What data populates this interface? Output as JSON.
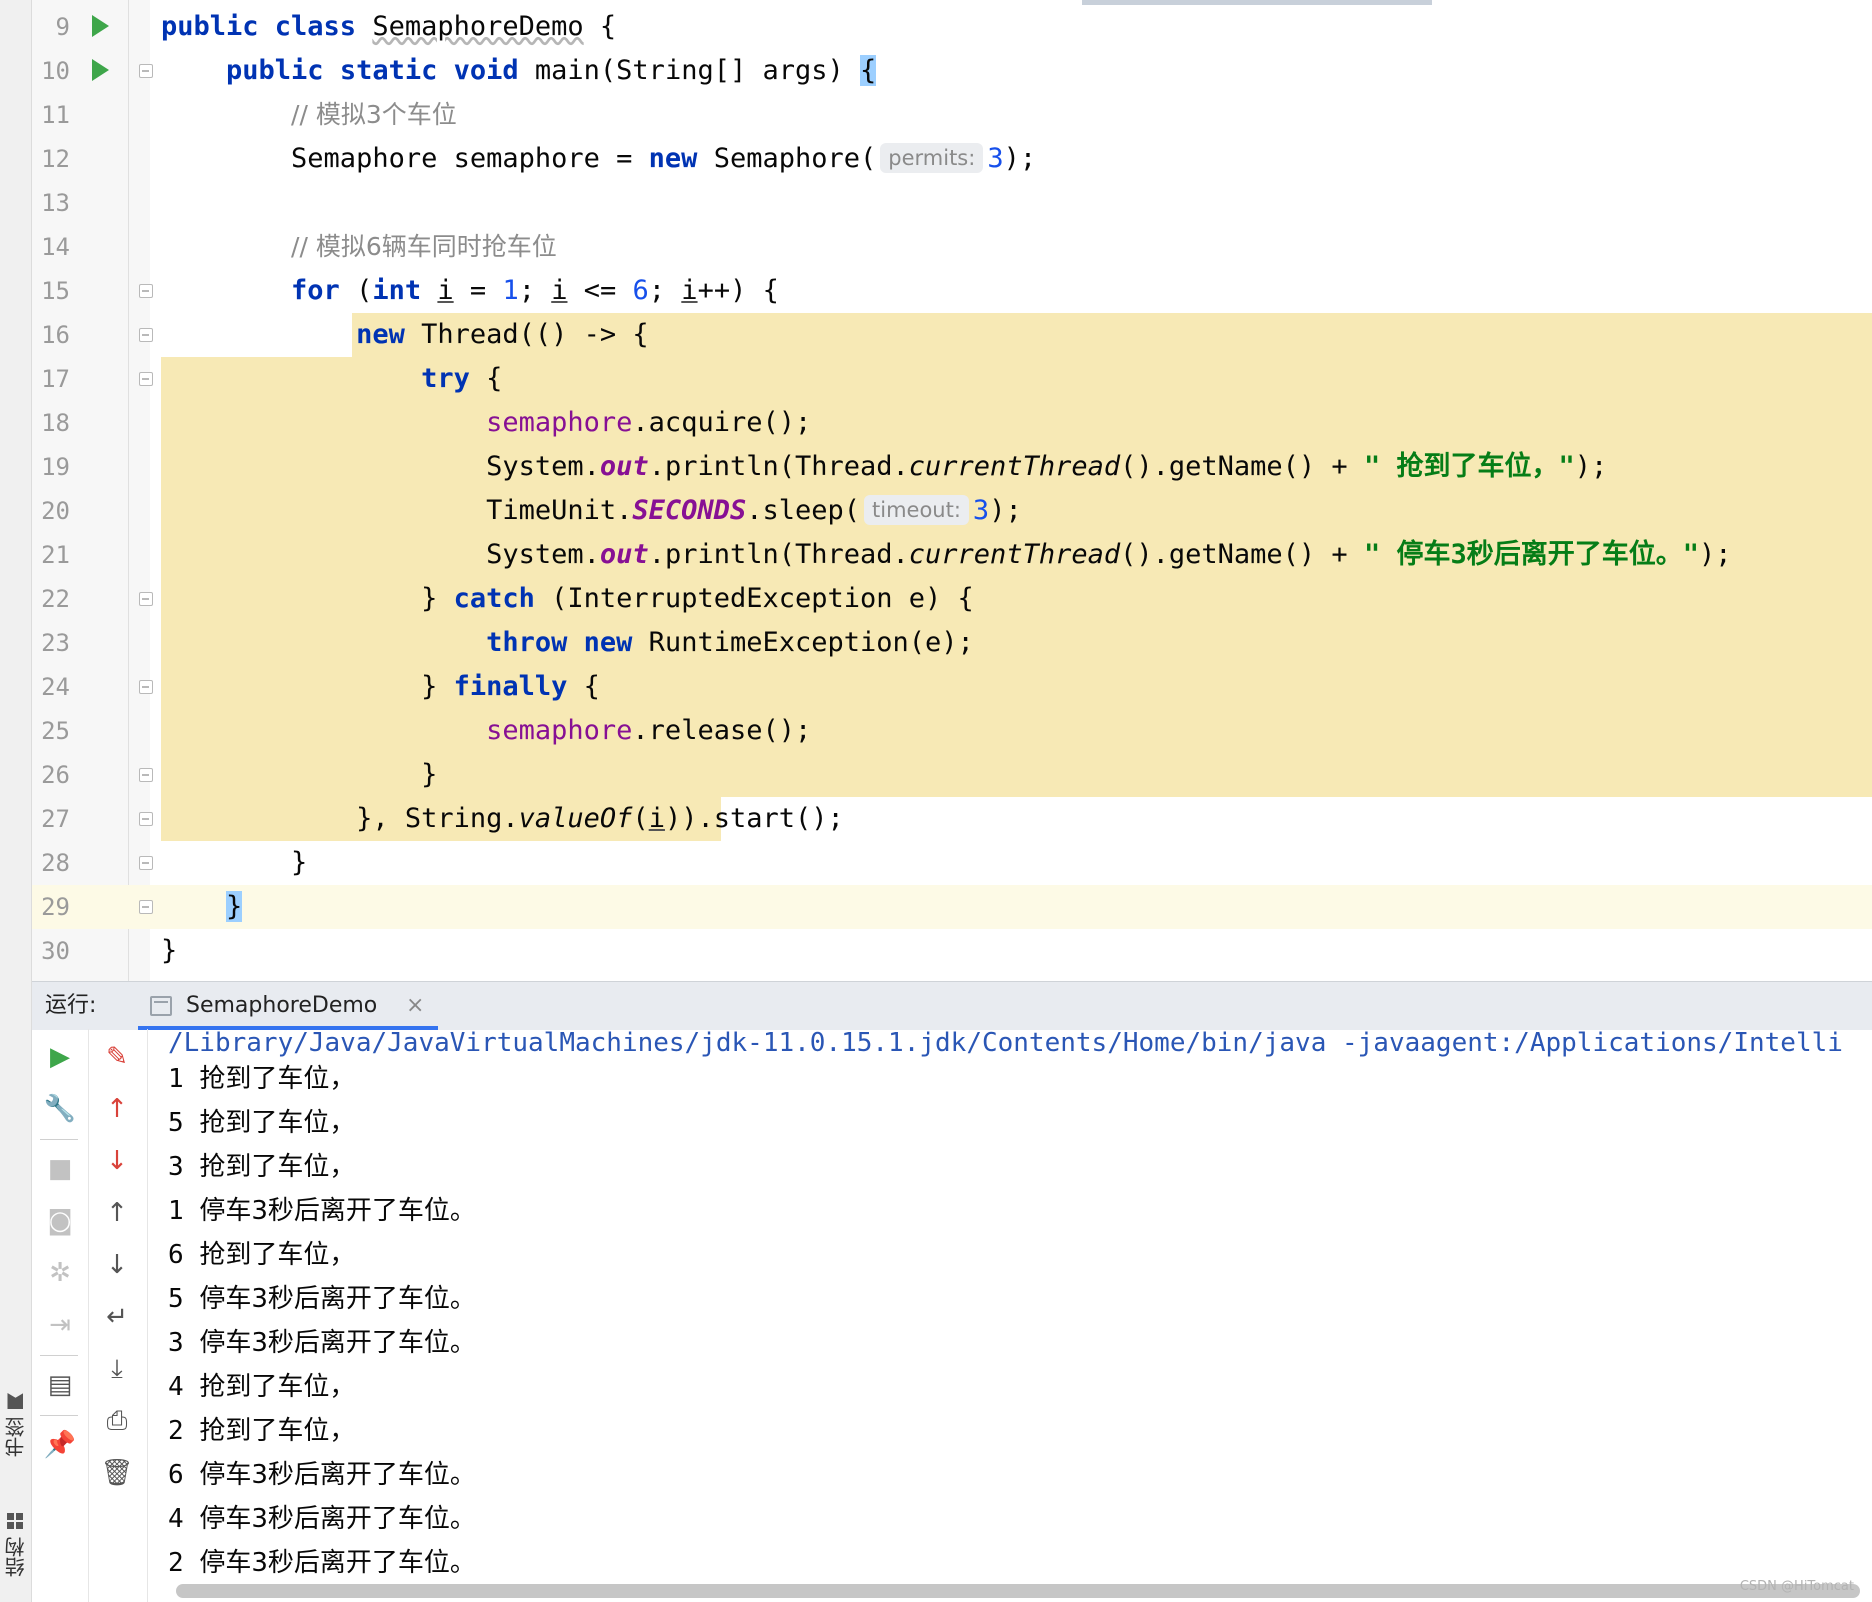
{
  "side_tabs": {
    "bookmarks": "书签",
    "structure": "结构"
  },
  "code_lines": [
    {
      "n": "9",
      "text": "public class SemaphoreDemo {"
    },
    {
      "n": "10",
      "text": "public static void main(String[] args) {"
    },
    {
      "n": "11",
      "text": "// 模拟3个车位"
    },
    {
      "n": "12",
      "text": "Semaphore semaphore = new Semaphore( permits: 3);"
    },
    {
      "n": "13",
      "text": ""
    },
    {
      "n": "14",
      "text": "// 模拟6辆车同时抢车位"
    },
    {
      "n": "15",
      "text": "for (int i = 1; i <= 6; i++) {"
    },
    {
      "n": "16",
      "text": "new Thread(() -> {"
    },
    {
      "n": "17",
      "text": "try {"
    },
    {
      "n": "18",
      "text": "semaphore.acquire();"
    },
    {
      "n": "19",
      "text": "System.out.println(Thread.currentThread().getName() + \" 抢到了车位，\");"
    },
    {
      "n": "20",
      "text": "TimeUnit.SECONDS.sleep( timeout: 3);"
    },
    {
      "n": "21",
      "text": "System.out.println(Thread.currentThread().getName() + \" 停车3秒后离开了车位。\");"
    },
    {
      "n": "22",
      "text": "} catch (InterruptedException e) {"
    },
    {
      "n": "23",
      "text": "throw new RuntimeException(e);"
    },
    {
      "n": "24",
      "text": "} finally {"
    },
    {
      "n": "25",
      "text": "semaphore.release();"
    },
    {
      "n": "26",
      "text": "}"
    },
    {
      "n": "27",
      "text": "}, String.valueOf(i)).start();"
    },
    {
      "n": "28",
      "text": "}"
    },
    {
      "n": "29",
      "text": "}"
    },
    {
      "n": "30",
      "text": "}"
    }
  ],
  "hints": {
    "permits": "permits:",
    "timeout": "timeout:"
  },
  "run_panel": {
    "label": "运行:",
    "tab_name": "SemaphoreDemo",
    "tab_close": "×",
    "command": "/Library/Java/JavaVirtualMachines/jdk-11.0.15.1.jdk/Contents/Home/bin/java -javaagent:/Applications/Intelli",
    "output": [
      {
        "id": "1",
        "msg": "抢到了车位，"
      },
      {
        "id": "5",
        "msg": "抢到了车位，"
      },
      {
        "id": "3",
        "msg": "抢到了车位，"
      },
      {
        "id": "1",
        "msg": "停车3秒后离开了车位。"
      },
      {
        "id": "6",
        "msg": "抢到了车位，"
      },
      {
        "id": "5",
        "msg": "停车3秒后离开了车位。"
      },
      {
        "id": "3",
        "msg": "停车3秒后离开了车位。"
      },
      {
        "id": "4",
        "msg": "抢到了车位，"
      },
      {
        "id": "2",
        "msg": "抢到了车位，"
      },
      {
        "id": "6",
        "msg": "停车3秒后离开了车位。"
      },
      {
        "id": "4",
        "msg": "停车3秒后离开了车位。"
      },
      {
        "id": "2",
        "msg": "停车3秒后离开了车位。"
      }
    ]
  },
  "toolbar_icons": {
    "col1": [
      "rerun-icon",
      "wrench-icon",
      "stop-icon",
      "camera-icon",
      "settings-bug-icon",
      "exit-icon",
      "layout-icon",
      "pin-icon"
    ],
    "col2": [
      "clear-icon",
      "prev-error-icon",
      "next-error-icon",
      "up-arrow-icon",
      "down-arrow-icon",
      "soft-wrap-icon",
      "scroll-to-end-icon",
      "print-icon",
      "trash-icon"
    ]
  },
  "watermark": "CSDN @HiTomcat",
  "colors": {
    "keyword": "#0033b3",
    "number": "#1750eb",
    "field": "#871094",
    "string": "#067d17",
    "comment": "#8c8c8c",
    "highlight": "#f7e9b5",
    "accent": "#3574f0"
  }
}
